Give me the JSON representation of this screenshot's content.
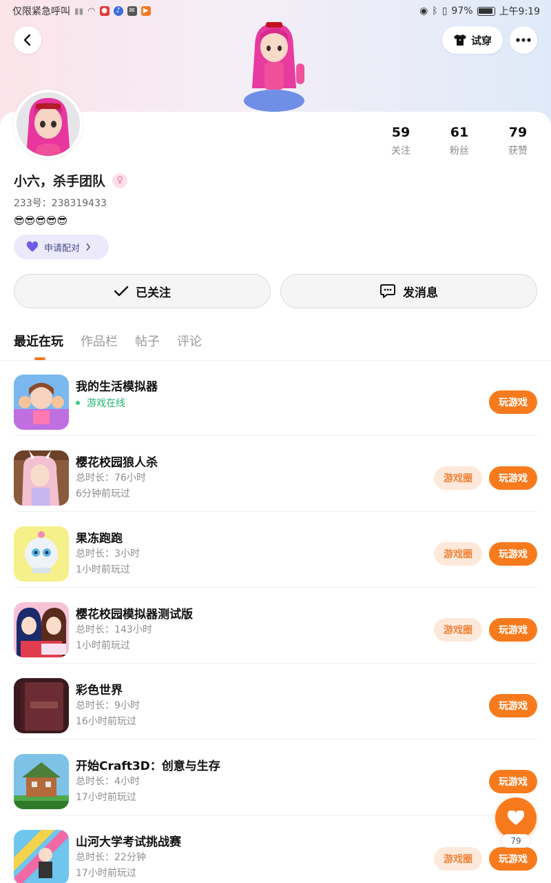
{
  "status_bar": {
    "left_text": "仅限紧急呼叫",
    "battery": "97%",
    "time": "上午9:19"
  },
  "header": {
    "tryon_label": "试穿"
  },
  "profile": {
    "stats": [
      {
        "value": "59",
        "label": "关注"
      },
      {
        "value": "61",
        "label": "粉丝"
      },
      {
        "value": "79",
        "label": "获赞"
      }
    ],
    "nickname": "小六，杀手团队",
    "uid_label": "233号：",
    "uid_value": "238319433",
    "bio": "😎😎😎😎😎",
    "pair_label": "申请配对",
    "follow_label": "已关注",
    "message_label": "发消息"
  },
  "tabs": [
    {
      "label": "最近在玩",
      "active": true
    },
    {
      "label": "作品栏",
      "active": false
    },
    {
      "label": "帖子",
      "active": false
    },
    {
      "label": "评论",
      "active": false
    }
  ],
  "games": [
    {
      "title": "我的生活模拟器",
      "status": "游戏在线",
      "play_label": "玩游戏",
      "icon_color": "#7ab8ef"
    },
    {
      "title": "樱花校园狼人杀",
      "meta1": "总时长：76小时",
      "meta2": "6分钟前玩过",
      "circle_label": "游戏圈",
      "play_label": "玩游戏",
      "icon_color": "#8a5a3c"
    },
    {
      "title": "果冻跑跑",
      "meta1": "总时长：3小时",
      "meta2": "1小时前玩过",
      "circle_label": "游戏圈",
      "play_label": "玩游戏",
      "icon_color": "#f6f08a"
    },
    {
      "title": "樱花校园模拟器测试版",
      "meta1": "总时长：143小时",
      "meta2": "1小时前玩过",
      "circle_label": "游戏圈",
      "play_label": "玩游戏",
      "icon_color": "#f6c3d6"
    },
    {
      "title": "彩色世界",
      "meta1": "总时长：9小时",
      "meta2": "16小时前玩过",
      "play_label": "玩游戏",
      "icon_color": "#5a2b2e"
    },
    {
      "title": "开始Craft3D：创意与生存",
      "meta1": "总时长：4小时",
      "meta2": "17小时前玩过",
      "play_label": "玩游戏",
      "icon_color": "#7fc2e8"
    },
    {
      "title": "山河大学考试挑战赛",
      "meta1": "总时长：22分钟",
      "meta2": "17小时前玩过",
      "circle_label": "游戏圈",
      "play_label": "玩游戏",
      "icon_color": "#6ec6ef"
    }
  ],
  "fab": {
    "count": "79"
  },
  "colors": {
    "accent": "#f77a1c",
    "online": "#22b573"
  }
}
